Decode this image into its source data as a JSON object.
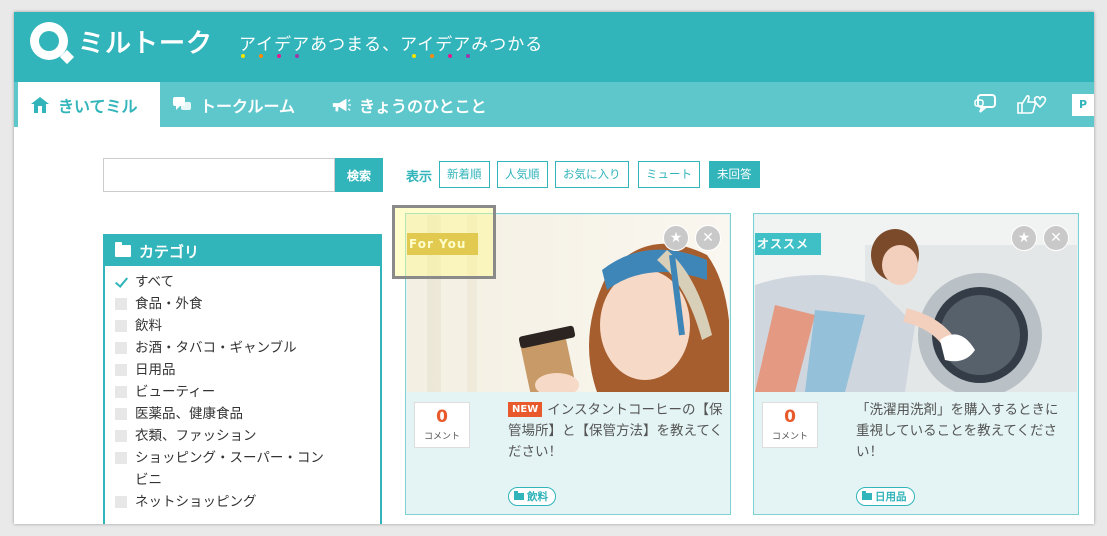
{
  "header": {
    "logo_text": "ミルトーク",
    "tagline": "アイデアあつまる、アイデアみつかる",
    "dot_colors": [
      "#f5e400",
      "#ff8a00",
      "#e8198b",
      "#9d3aa8"
    ]
  },
  "nav": {
    "items": [
      {
        "label": "きいてミル",
        "icon": "house-icon"
      },
      {
        "label": "トークルーム",
        "icon": "chat-bubbles-icon"
      },
      {
        "label": "きょうのひとこと",
        "icon": "megaphone-icon"
      }
    ],
    "user_initial": "P"
  },
  "search": {
    "placeholder": "",
    "button_label": "検索"
  },
  "filters": {
    "label": "表示",
    "options": [
      "新着順",
      "人気順",
      "お気に入り",
      "ミュート",
      "未回答"
    ],
    "active": "未回答"
  },
  "categories": {
    "title": "カテゴリ",
    "items": [
      {
        "label": "すべて",
        "checked": true
      },
      {
        "label": "食品・外食",
        "checked": false
      },
      {
        "label": "飲料",
        "checked": false
      },
      {
        "label": "お酒・タバコ・ギャンブル",
        "checked": false
      },
      {
        "label": "日用品",
        "checked": false
      },
      {
        "label": "ビューティー",
        "checked": false
      },
      {
        "label": "医薬品、健康食品",
        "checked": false
      },
      {
        "label": "衣類、ファッション",
        "checked": false
      },
      {
        "label": "ショッピング・スーパー・コンビニ",
        "checked": false
      },
      {
        "label": "ネットショッピング",
        "checked": false
      }
    ]
  },
  "cards": [
    {
      "ribbon": "For You",
      "ribbon_color": "#c9a21e",
      "count": "0",
      "count_label": "コメント",
      "badge": "NEW",
      "title": "インスタントコーヒーの【保管場所】と【保管方法】を教えてください！",
      "tag": "飲料"
    },
    {
      "ribbon": "オススメ",
      "ribbon_color": "#3fc0c6",
      "count": "0",
      "count_label": "コメント",
      "badge": "",
      "title": "「洗濯用洗剤」を購入するときに重視していることを教えてください！",
      "tag": "日用品"
    }
  ],
  "colors": {
    "brand": "#31b4ba",
    "accent": "#e85a2c"
  }
}
